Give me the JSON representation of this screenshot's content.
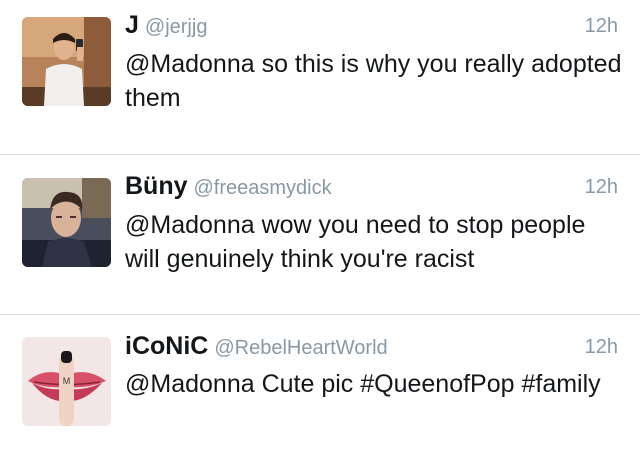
{
  "tweets": [
    {
      "name": "J",
      "handle": "@jerjjg",
      "time": "12h",
      "text": "@Madonna so this is why you really adopted them",
      "avatar_icon": "profile-photo-selfie"
    },
    {
      "name": "Büny",
      "handle": "@freeasmydick",
      "time": "12h",
      "text": "@Madonna wow you need to stop people will genuinely think you're racist",
      "avatar_icon": "profile-photo-portrait"
    },
    {
      "name": "iCoNiC",
      "handle": "@RebelHeartWorld",
      "time": "12h",
      "text": "@Madonna Cute pic #QueenofPop #family",
      "avatar_icon": "profile-photo-lips-finger"
    }
  ],
  "colors": {
    "name": "#14171a",
    "muted": "#8899a6",
    "divider": "#d8dadd"
  }
}
